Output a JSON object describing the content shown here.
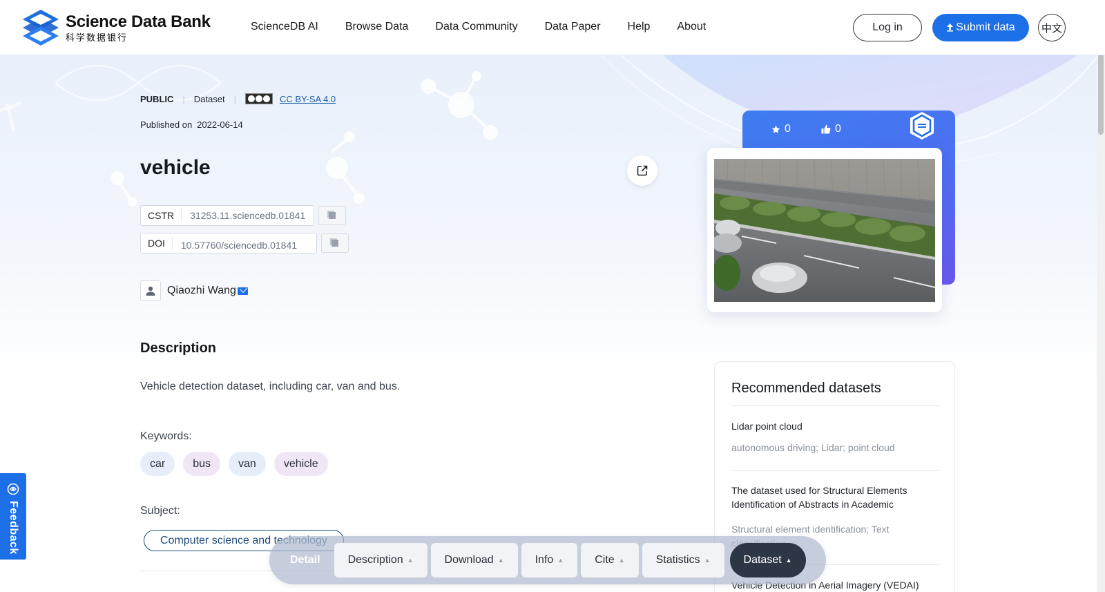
{
  "header": {
    "logo": {
      "name": "Science Data Bank",
      "name_cn": "科学数据银行"
    },
    "nav": [
      "ScienceDB AI",
      "Browse Data",
      "Data Community",
      "Data Paper",
      "Help",
      "About"
    ],
    "login_label": "Log in",
    "submit_label": "Submit data",
    "lang_label": "中文"
  },
  "dataset": {
    "visibility": "PUBLIC",
    "type": "Dataset",
    "license": "CC BY-SA 4.0",
    "published_label": "Published on",
    "published_date": "2022-06-14",
    "title": "vehicle",
    "cstr_label": "CSTR",
    "cstr": "31253.11.sciencedb.01841",
    "doi_label": "DOI",
    "doi": "10.57760/sciencedb.01841",
    "author": "Qiaozhi Wang"
  },
  "description": {
    "heading": "Description",
    "text": "Vehicle detection dataset, including car, van and bus."
  },
  "keywords": {
    "label": "Keywords:",
    "items": [
      "car",
      "bus",
      "van",
      "vehicle"
    ]
  },
  "subject": {
    "label": "Subject:",
    "value": "Computer science and technology"
  },
  "stats": {
    "stars": "0",
    "likes": "0"
  },
  "recommended": {
    "title": "Recommended datasets",
    "items": [
      {
        "title": "Lidar point cloud",
        "keywords": "autonomous driving; Lidar; point cloud"
      },
      {
        "title": "The dataset used for Structural Elements Identification of Abstracts in Academic",
        "keywords": "Structural element identification; Text classification"
      },
      {
        "title": "Vehicle Detection in Aerial Imagery (VEDAI)",
        "keywords": ""
      }
    ]
  },
  "feedback_label": "Feedback",
  "dock": {
    "detail_label": "Detail",
    "items": [
      "Description",
      "Download",
      "Info",
      "Cite",
      "Statistics",
      "Dataset"
    ]
  },
  "colors": {
    "accent": "#1d6fe8",
    "dark_button": "#2c3645"
  }
}
